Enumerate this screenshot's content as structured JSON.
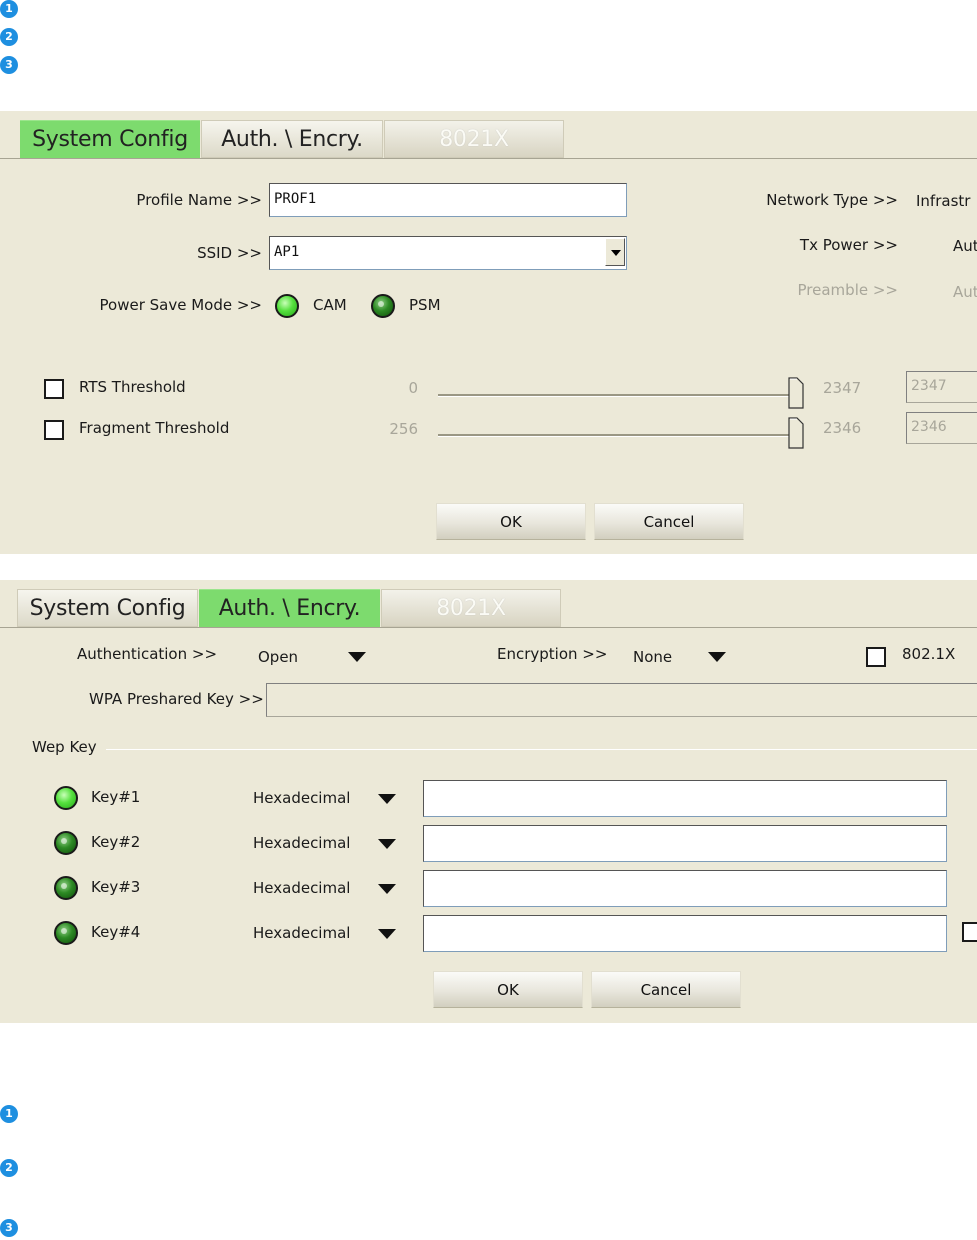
{
  "badges": [
    "1",
    "2",
    "3"
  ],
  "system_config_panel": {
    "tabs": [
      {
        "label": "System Config",
        "state": "active"
      },
      {
        "label": "Auth. \\ Encry.",
        "state": "normal"
      },
      {
        "label": "8021X",
        "state": "disabled"
      }
    ],
    "profile_name": {
      "label": "Profile Name >>",
      "value": "PROF1"
    },
    "ssid": {
      "label": "SSID >>",
      "value": "AP1"
    },
    "power_save": {
      "label": "Power Save Mode >>",
      "options": [
        {
          "label": "CAM",
          "selected": true
        },
        {
          "label": "PSM",
          "selected": false
        }
      ]
    },
    "network_type": {
      "label": "Network Type >>",
      "value": "Infrastr"
    },
    "tx_power": {
      "label": "Tx Power >>",
      "value": "Aut"
    },
    "preamble": {
      "label": "Preamble >>",
      "value": "Aut"
    },
    "rts": {
      "label": "RTS Threshold",
      "checked": false,
      "min": "0",
      "max": "2347",
      "value": "2347"
    },
    "fragment": {
      "label": "Fragment Threshold",
      "checked": false,
      "min": "256",
      "max": "2346",
      "value": "2346"
    },
    "ok_label": "OK",
    "cancel_label": "Cancel"
  },
  "auth_panel": {
    "tabs": [
      {
        "label": "System Config",
        "state": "normal"
      },
      {
        "label": "Auth. \\ Encry.",
        "state": "active"
      },
      {
        "label": "8021X",
        "state": "disabled"
      }
    ],
    "authentication": {
      "label": "Authentication >>",
      "value": "Open"
    },
    "encryption": {
      "label": "Encryption >>",
      "value": "None"
    },
    "ieee8021x": {
      "label": "802.1X",
      "checked": false
    },
    "wpa_psk": {
      "label": "WPA Preshared Key >>",
      "value": ""
    },
    "wep_group_label": "Wep Key",
    "keys": [
      {
        "label": "Key#1",
        "selected": true,
        "format": "Hexadecimal",
        "value": ""
      },
      {
        "label": "Key#2",
        "selected": false,
        "format": "Hexadecimal",
        "value": ""
      },
      {
        "label": "Key#3",
        "selected": false,
        "format": "Hexadecimal",
        "value": ""
      },
      {
        "label": "Key#4",
        "selected": false,
        "format": "Hexadecimal",
        "value": ""
      }
    ],
    "ok_label": "OK",
    "cancel_label": "Cancel"
  },
  "colors": {
    "active_tab": "#7ddb6e",
    "panel_bg": "#ece9d8",
    "badge": "#1e8fe0"
  }
}
